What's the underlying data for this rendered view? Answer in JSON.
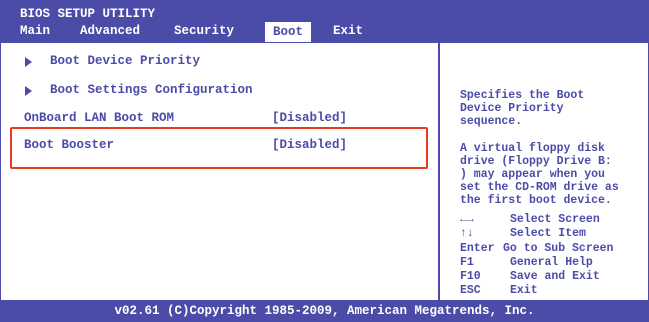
{
  "header": {
    "title": "BIOS SETUP UTILITY",
    "tabs": [
      "Main",
      "Advanced",
      "Security",
      "Boot",
      "Exit"
    ]
  },
  "menu": {
    "items": [
      {
        "label": "Boot Device Priority"
      },
      {
        "label": "Boot Settings Configuration"
      },
      {
        "label": "OnBoard LAN Boot ROM",
        "value": "[Disabled]"
      },
      {
        "label": "Boot Booster",
        "value": "[Disabled]"
      }
    ]
  },
  "help": {
    "description": [
      "Specifies the Boot",
      "Device Priority",
      "sequence."
    ],
    "note": [
      "A virtual floppy disk",
      "drive (Floppy Drive B:",
      ") may appear when you",
      "set the CD-ROM drive as",
      "the first boot device."
    ],
    "keys": [
      {
        "key": "←→",
        "action": "Select Screen"
      },
      {
        "key": "↑↓",
        "action": "Select Item"
      },
      {
        "key": "Enter",
        "action": "Go to Sub Screen"
      },
      {
        "key": "F1",
        "action": "General Help"
      },
      {
        "key": "F10",
        "action": "Save and Exit"
      },
      {
        "key": "ESC",
        "action": "Exit"
      }
    ]
  },
  "footer": {
    "text": "v02.61 (C)Copyright 1985-2009, American Megatrends, Inc."
  },
  "colors": {
    "primary": "#4b4ba8",
    "highlight_border": "#e53b1f",
    "background": "#ffffff"
  }
}
